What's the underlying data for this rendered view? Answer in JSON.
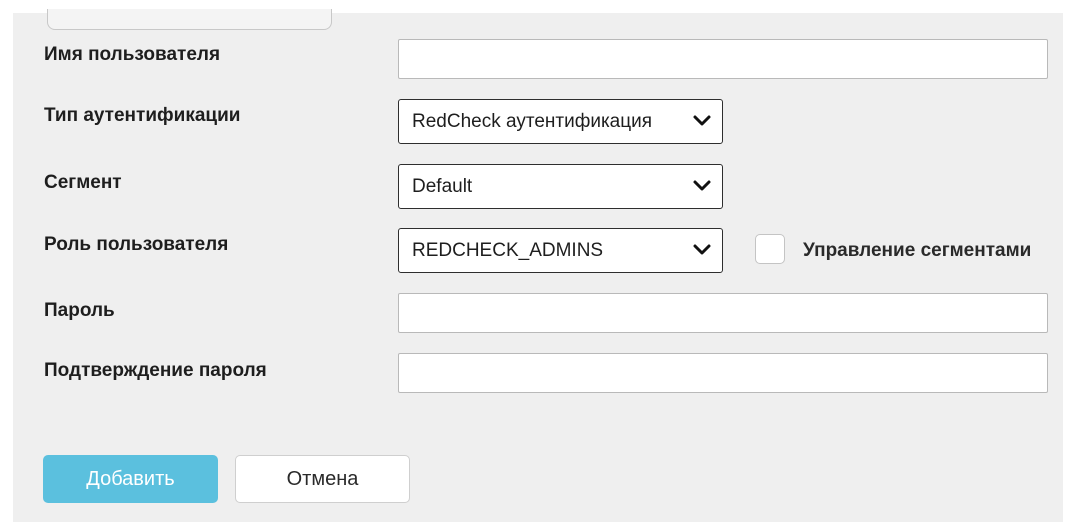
{
  "form": {
    "username": {
      "label": "Имя пользователя",
      "value": "",
      "placeholder": ""
    },
    "auth_type": {
      "label": "Тип аутентификации",
      "selected": "RedCheck аутентификация"
    },
    "segment": {
      "label": "Сегмент",
      "selected": "Default"
    },
    "user_role": {
      "label": "Роль пользователя",
      "selected": "REDCHECK_ADMINS",
      "manage_segments": {
        "label": "Управление сегментами",
        "checked": false
      }
    },
    "password": {
      "label": "Пароль",
      "value": ""
    },
    "password_confirm": {
      "label": "Подтверждение пароля",
      "value": ""
    }
  },
  "actions": {
    "add_label": "Добавить",
    "cancel_label": "Отмена"
  },
  "colors": {
    "primary_button": "#5bc0de",
    "panel_background": "#efefef"
  },
  "icons": {
    "select_arrow": "chevron-down-icon"
  }
}
